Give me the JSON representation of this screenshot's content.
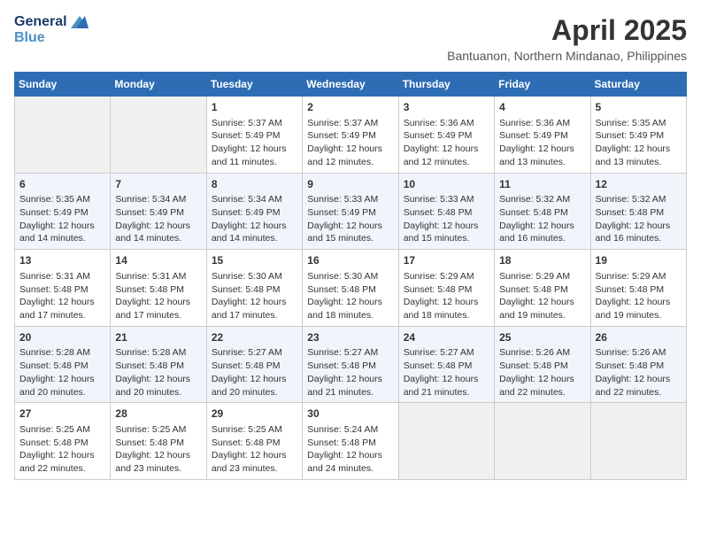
{
  "header": {
    "logo_line1": "General",
    "logo_line2": "Blue",
    "month": "April 2025",
    "location": "Bantuanon, Northern Mindanao, Philippines"
  },
  "weekdays": [
    "Sunday",
    "Monday",
    "Tuesday",
    "Wednesday",
    "Thursday",
    "Friday",
    "Saturday"
  ],
  "weeks": [
    [
      {
        "day": "",
        "info": ""
      },
      {
        "day": "",
        "info": ""
      },
      {
        "day": "1",
        "info": "Sunrise: 5:37 AM\nSunset: 5:49 PM\nDaylight: 12 hours and 11 minutes."
      },
      {
        "day": "2",
        "info": "Sunrise: 5:37 AM\nSunset: 5:49 PM\nDaylight: 12 hours and 12 minutes."
      },
      {
        "day": "3",
        "info": "Sunrise: 5:36 AM\nSunset: 5:49 PM\nDaylight: 12 hours and 12 minutes."
      },
      {
        "day": "4",
        "info": "Sunrise: 5:36 AM\nSunset: 5:49 PM\nDaylight: 12 hours and 13 minutes."
      },
      {
        "day": "5",
        "info": "Sunrise: 5:35 AM\nSunset: 5:49 PM\nDaylight: 12 hours and 13 minutes."
      }
    ],
    [
      {
        "day": "6",
        "info": "Sunrise: 5:35 AM\nSunset: 5:49 PM\nDaylight: 12 hours and 14 minutes."
      },
      {
        "day": "7",
        "info": "Sunrise: 5:34 AM\nSunset: 5:49 PM\nDaylight: 12 hours and 14 minutes."
      },
      {
        "day": "8",
        "info": "Sunrise: 5:34 AM\nSunset: 5:49 PM\nDaylight: 12 hours and 14 minutes."
      },
      {
        "day": "9",
        "info": "Sunrise: 5:33 AM\nSunset: 5:49 PM\nDaylight: 12 hours and 15 minutes."
      },
      {
        "day": "10",
        "info": "Sunrise: 5:33 AM\nSunset: 5:48 PM\nDaylight: 12 hours and 15 minutes."
      },
      {
        "day": "11",
        "info": "Sunrise: 5:32 AM\nSunset: 5:48 PM\nDaylight: 12 hours and 16 minutes."
      },
      {
        "day": "12",
        "info": "Sunrise: 5:32 AM\nSunset: 5:48 PM\nDaylight: 12 hours and 16 minutes."
      }
    ],
    [
      {
        "day": "13",
        "info": "Sunrise: 5:31 AM\nSunset: 5:48 PM\nDaylight: 12 hours and 17 minutes."
      },
      {
        "day": "14",
        "info": "Sunrise: 5:31 AM\nSunset: 5:48 PM\nDaylight: 12 hours and 17 minutes."
      },
      {
        "day": "15",
        "info": "Sunrise: 5:30 AM\nSunset: 5:48 PM\nDaylight: 12 hours and 17 minutes."
      },
      {
        "day": "16",
        "info": "Sunrise: 5:30 AM\nSunset: 5:48 PM\nDaylight: 12 hours and 18 minutes."
      },
      {
        "day": "17",
        "info": "Sunrise: 5:29 AM\nSunset: 5:48 PM\nDaylight: 12 hours and 18 minutes."
      },
      {
        "day": "18",
        "info": "Sunrise: 5:29 AM\nSunset: 5:48 PM\nDaylight: 12 hours and 19 minutes."
      },
      {
        "day": "19",
        "info": "Sunrise: 5:29 AM\nSunset: 5:48 PM\nDaylight: 12 hours and 19 minutes."
      }
    ],
    [
      {
        "day": "20",
        "info": "Sunrise: 5:28 AM\nSunset: 5:48 PM\nDaylight: 12 hours and 20 minutes."
      },
      {
        "day": "21",
        "info": "Sunrise: 5:28 AM\nSunset: 5:48 PM\nDaylight: 12 hours and 20 minutes."
      },
      {
        "day": "22",
        "info": "Sunrise: 5:27 AM\nSunset: 5:48 PM\nDaylight: 12 hours and 20 minutes."
      },
      {
        "day": "23",
        "info": "Sunrise: 5:27 AM\nSunset: 5:48 PM\nDaylight: 12 hours and 21 minutes."
      },
      {
        "day": "24",
        "info": "Sunrise: 5:27 AM\nSunset: 5:48 PM\nDaylight: 12 hours and 21 minutes."
      },
      {
        "day": "25",
        "info": "Sunrise: 5:26 AM\nSunset: 5:48 PM\nDaylight: 12 hours and 22 minutes."
      },
      {
        "day": "26",
        "info": "Sunrise: 5:26 AM\nSunset: 5:48 PM\nDaylight: 12 hours and 22 minutes."
      }
    ],
    [
      {
        "day": "27",
        "info": "Sunrise: 5:25 AM\nSunset: 5:48 PM\nDaylight: 12 hours and 22 minutes."
      },
      {
        "day": "28",
        "info": "Sunrise: 5:25 AM\nSunset: 5:48 PM\nDaylight: 12 hours and 23 minutes."
      },
      {
        "day": "29",
        "info": "Sunrise: 5:25 AM\nSunset: 5:48 PM\nDaylight: 12 hours and 23 minutes."
      },
      {
        "day": "30",
        "info": "Sunrise: 5:24 AM\nSunset: 5:48 PM\nDaylight: 12 hours and 24 minutes."
      },
      {
        "day": "",
        "info": ""
      },
      {
        "day": "",
        "info": ""
      },
      {
        "day": "",
        "info": ""
      }
    ]
  ]
}
